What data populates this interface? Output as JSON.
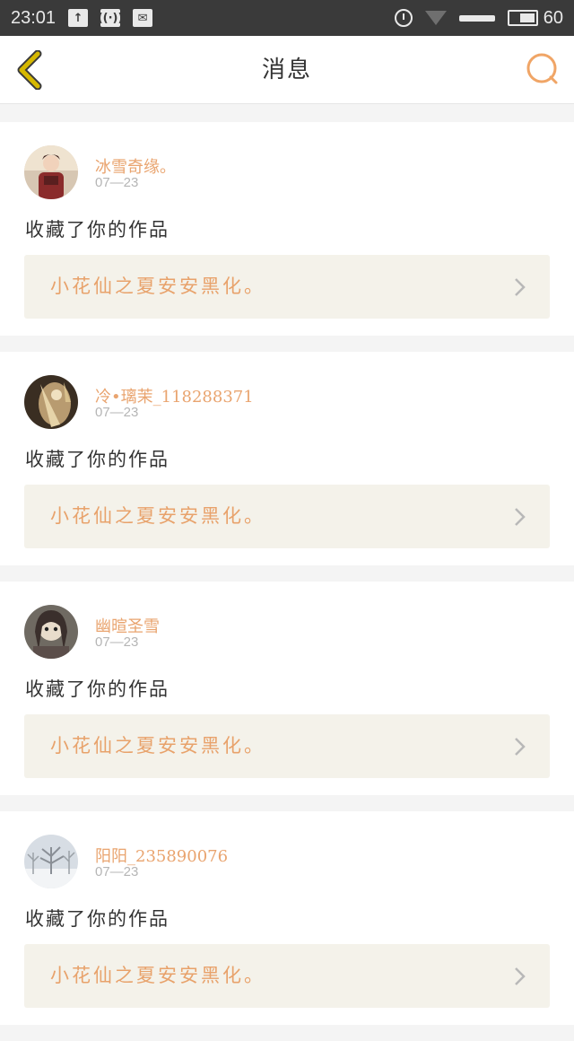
{
  "status_bar": {
    "time": "23:01",
    "battery_text": "60",
    "battery_level_percent": 60,
    "icons": [
      "upload-icon",
      "wireless-icon",
      "message-icon",
      "alarm-icon",
      "wifi-icon",
      "signal-icon",
      "battery-icon"
    ]
  },
  "header": {
    "title": "消息",
    "back_icon": "back-chevron-icon",
    "search_icon": "search-icon"
  },
  "colors": {
    "accent": "#e9a46f",
    "back_icon": "#d6b800",
    "search_icon": "#f0a566",
    "work_card_bg": "#f4f2ea"
  },
  "notifications": [
    {
      "username": "冰雪奇缘。",
      "date": "07—23",
      "action": "收藏了你的作品",
      "work_title": "小花仙之夏安安黑化。",
      "avatar": "avatar-girl-red"
    },
    {
      "username": "冷•璃茉_118288371",
      "date": "07—23",
      "action": "收藏了你的作品",
      "work_title": "小花仙之夏安安黑化。",
      "avatar": "avatar-anime-gold"
    },
    {
      "username": "幽暄圣雪",
      "date": "07—23",
      "action": "收藏了你的作品",
      "work_title": "小花仙之夏安安黑化。",
      "avatar": "avatar-anime-dark"
    },
    {
      "username": "阳阳_235890076",
      "date": "07—23",
      "action": "收藏了你的作品",
      "work_title": "小花仙之夏安安黑化。",
      "avatar": "avatar-winter-tree"
    }
  ]
}
